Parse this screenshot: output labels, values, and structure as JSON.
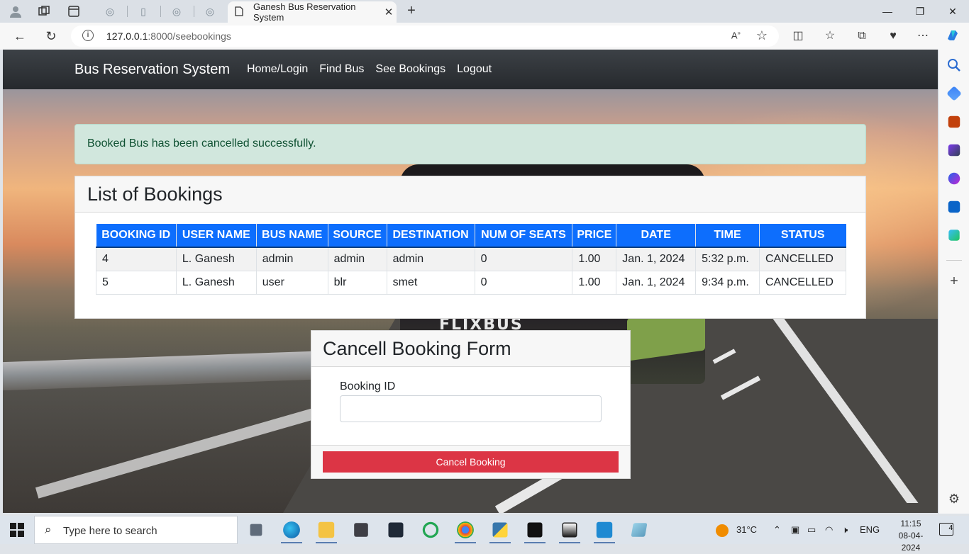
{
  "browser": {
    "active_tab_title": "Ganesh Bus Reservation System",
    "url_host": "127.0.0.1",
    "url_path": ":8000/seebookings"
  },
  "navbar": {
    "brand": "Bus Reservation System",
    "links": [
      "Home/Login",
      "Find Bus",
      "See Bookings",
      "Logout"
    ]
  },
  "alert": {
    "message": "Booked Bus has been cancelled successfully."
  },
  "background": {
    "bus_logo": "FLIXBUS"
  },
  "bookings": {
    "title": "List of Bookings",
    "columns": [
      "BOOKING ID",
      "USER NAME",
      "BUS NAME",
      "SOURCE",
      "DESTINATION",
      "NUM OF SEATS",
      "PRICE",
      "DATE",
      "TIME",
      "STATUS"
    ],
    "rows": [
      [
        "4",
        "L. Ganesh",
        "admin",
        "admin",
        "admin",
        "0",
        "1.00",
        "Jan. 1, 2024",
        "5:32 p.m.",
        "CANCELLED"
      ],
      [
        "5",
        "L. Ganesh",
        "user",
        "blr",
        "smet",
        "0",
        "1.00",
        "Jan. 1, 2024",
        "9:34 p.m.",
        "CANCELLED"
      ]
    ]
  },
  "cancel_form": {
    "title": "Cancell Booking Form",
    "label": "Booking ID",
    "input_value": "",
    "button": "Cancel Booking"
  },
  "taskbar": {
    "search_placeholder": "Type here to search",
    "weather": "31°C",
    "language": "ENG",
    "time": "11:15",
    "date": "08-04-2024",
    "notification_count": "4"
  },
  "colors": {
    "navbar": "#2b2f33",
    "table_header": "#0d6efd",
    "alert_bg": "#d1e7dd",
    "alert_text": "#0f5132",
    "cancel_button": "#dc3545"
  },
  "icons": {
    "tabbar": [
      "profile-icon",
      "workspaces-icon",
      "tab-actions-icon"
    ],
    "toolbar": [
      "back-icon",
      "refresh-icon",
      "read-aloud-icon",
      "favorite-icon",
      "split-screen-icon",
      "favorites-icon",
      "collections-icon",
      "health-icon",
      "more-icon",
      "copilot-icon"
    ],
    "sidebar": [
      "search-icon",
      "tag-icon",
      "toolbox-icon",
      "games-icon",
      "office-icon",
      "outlook-icon",
      "send-icon",
      "add-icon",
      "settings-icon"
    ]
  }
}
